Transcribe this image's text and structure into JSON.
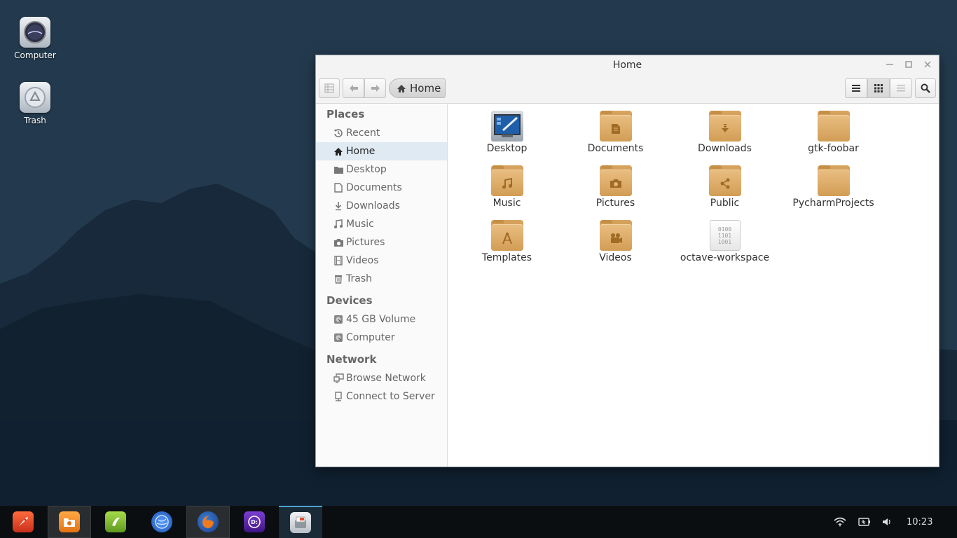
{
  "desktop": {
    "icons": [
      {
        "label": "Computer"
      },
      {
        "label": "Trash"
      }
    ]
  },
  "window": {
    "title": "Home",
    "breadcrumb": {
      "home_label": "Home"
    },
    "sidebar": {
      "places_heading": "Places",
      "places": [
        {
          "label": "Recent",
          "icon": "clock-icon"
        },
        {
          "label": "Home",
          "icon": "home-icon",
          "selected": true
        },
        {
          "label": "Desktop",
          "icon": "desktop-folder-icon"
        },
        {
          "label": "Documents",
          "icon": "document-icon"
        },
        {
          "label": "Downloads",
          "icon": "download-icon"
        },
        {
          "label": "Music",
          "icon": "music-icon"
        },
        {
          "label": "Pictures",
          "icon": "camera-icon"
        },
        {
          "label": "Videos",
          "icon": "film-icon"
        },
        {
          "label": "Trash",
          "icon": "trash-icon"
        }
      ],
      "devices_heading": "Devices",
      "devices": [
        {
          "label": "45 GB Volume",
          "icon": "drive-icon"
        },
        {
          "label": "Computer",
          "icon": "drive-icon"
        }
      ],
      "network_heading": "Network",
      "network": [
        {
          "label": "Browse Network",
          "icon": "network-icon"
        },
        {
          "label": "Connect to Server",
          "icon": "server-icon"
        }
      ]
    },
    "files": [
      {
        "label": "Desktop",
        "type": "desktop"
      },
      {
        "label": "Documents",
        "type": "folder",
        "emblem": "document-icon"
      },
      {
        "label": "Downloads",
        "type": "folder",
        "emblem": "download-icon"
      },
      {
        "label": "gtk-foobar",
        "type": "folder",
        "emblem": ""
      },
      {
        "label": "Music",
        "type": "folder",
        "emblem": "music-icon"
      },
      {
        "label": "Pictures",
        "type": "folder",
        "emblem": "camera-icon"
      },
      {
        "label": "Public",
        "type": "folder",
        "emblem": "share-icon"
      },
      {
        "label": "PycharmProjects",
        "type": "folder",
        "emblem": ""
      },
      {
        "label": "Templates",
        "type": "folder",
        "emblem": "compass-icon"
      },
      {
        "label": "Videos",
        "type": "folder",
        "emblem": "film-icon"
      },
      {
        "label": "octave-workspace",
        "type": "binary-file",
        "binary_text": [
          "0100",
          "1101",
          "1001"
        ]
      }
    ]
  },
  "taskbar": {
    "apps": [
      {
        "name": "rocket-launcher-icon",
        "color": "#e8502e"
      },
      {
        "name": "file-manager-icon",
        "color": "#f08a24"
      },
      {
        "name": "music-player-icon",
        "color": "#7cb82f"
      },
      {
        "name": "web-browser-icon",
        "color": "#2a6fdb"
      },
      {
        "name": "firefox-icon",
        "color": "#e0661f"
      },
      {
        "name": "deadbeef-icon",
        "color": "#5b2a9a"
      },
      {
        "name": "files-app-icon",
        "color": "#d0d4d8"
      }
    ],
    "clock": "10:23"
  }
}
